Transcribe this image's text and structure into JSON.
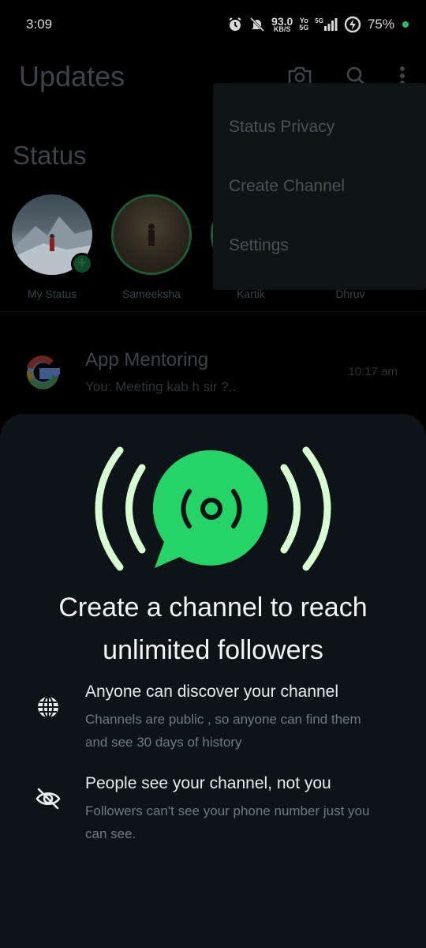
{
  "status_bar": {
    "time": "3:09",
    "net_speed": "93.0",
    "net_unit": "KB/S",
    "volte": "Yo",
    "volte_sub": "5G",
    "network": "5G",
    "battery": "75%",
    "icons": [
      "alarm-icon",
      "mute-bell-icon",
      "signal-icon",
      "battery-charging-icon"
    ],
    "battery_dot_color": "#21c063"
  },
  "appbar": {
    "title": "Updates",
    "icons": [
      "camera-icon",
      "search-icon",
      "more-vert-icon"
    ]
  },
  "status_section": {
    "title": "Status",
    "items": [
      {
        "name": "My Status"
      },
      {
        "name": "Sameeksha"
      },
      {
        "name": "Kartik"
      },
      {
        "name": "Dhruv"
      }
    ]
  },
  "chat": {
    "name": "App Mentoring",
    "last_message": "You: Meeting kab h sir ?..",
    "time": "10:17 am"
  },
  "menu": {
    "items": [
      "Status Privacy",
      "Create Channel",
      "Settings"
    ]
  },
  "sheet": {
    "headline": "Create a channel to reach unlimited followers",
    "accent_color": "#25d366",
    "features": [
      {
        "icon": "globe-icon",
        "title": "Anyone can discover your channel",
        "description": "Channels are public , so anyone can find them and see 30 days of history"
      },
      {
        "icon": "eye-off-icon",
        "title": "People see your channel, not you",
        "description": "Followers can't see your phone number just you can see."
      }
    ]
  }
}
